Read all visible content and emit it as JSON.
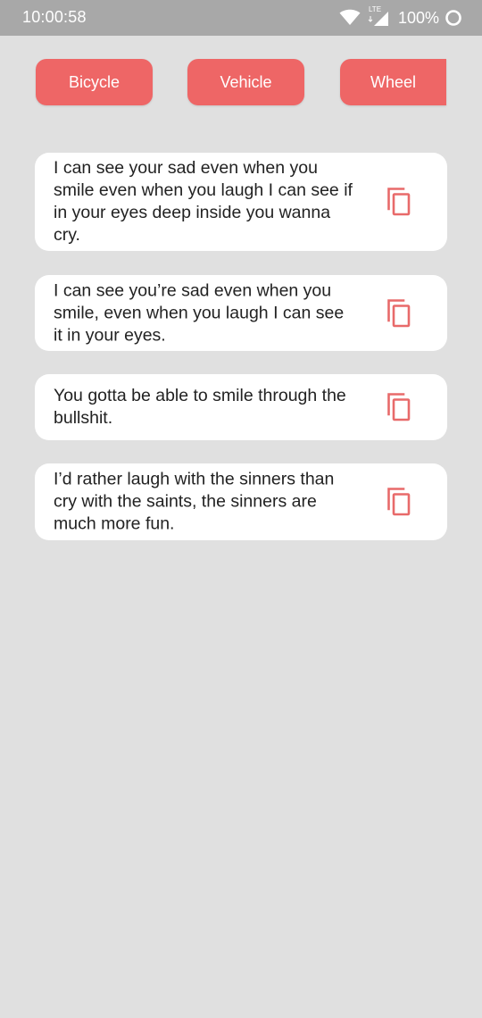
{
  "status_bar": {
    "time": "10:00:58",
    "network_label": "LTE",
    "battery": "100%"
  },
  "tabs": [
    {
      "label": "Bicycle"
    },
    {
      "label": "Vehicle"
    },
    {
      "label": "Wheel"
    }
  ],
  "quotes": [
    {
      "text": "I can see your sad even when you smile even when you laugh I can see if in your eyes deep inside you wanna cry.",
      "icon": "copy-icon"
    },
    {
      "text": "I can see you’re sad even when you smile, even when you laugh I can see it in your eyes.",
      "icon": "copy-icon"
    },
    {
      "text": "You gotta be able to smile through the bullshit.",
      "icon": "copy-icon"
    },
    {
      "text": "I’d rather laugh with the sinners than cry with the saints, the sinners are much more fun.",
      "icon": "copy-icon"
    }
  ],
  "colors": {
    "accent": "#ee6666",
    "background": "#e0e0e0",
    "status_bar": "#a8a8a8",
    "card": "#ffffff"
  }
}
